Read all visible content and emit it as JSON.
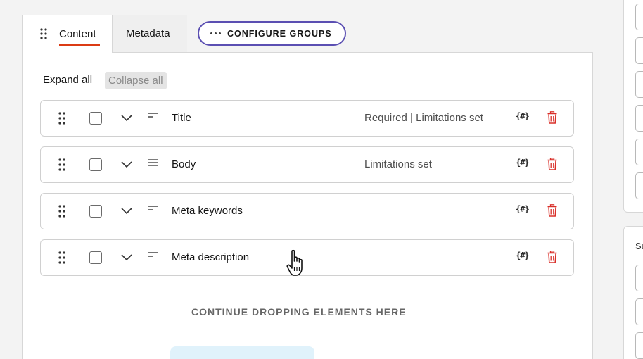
{
  "tabs": {
    "content_label": "Content",
    "metadata_label": "Metadata",
    "configure_groups_label": "CONFIGURE GROUPS"
  },
  "toolbar": {
    "expand_all": "Expand all",
    "collapse_all": "Collapse all"
  },
  "elements": [
    {
      "name": "Title",
      "type_icon": "text-short-icon",
      "status": "Required | Limitations set",
      "macro": "{#}"
    },
    {
      "name": "Body",
      "type_icon": "text-long-icon",
      "status": "Limitations set",
      "macro": "{#}"
    },
    {
      "name": "Meta keywords",
      "type_icon": "text-short-icon",
      "status": "",
      "macro": "{#}"
    },
    {
      "name": "Meta description",
      "type_icon": "text-short-icon",
      "status": "",
      "macro": "{#}"
    }
  ],
  "drop_zone": {
    "label": "CONTINUE DROPPING ELEMENTS HERE"
  },
  "right_panel": {
    "label_fragment": "Su"
  },
  "colors": {
    "accent_underline": "#db3b14",
    "configure_border": "#5b4fb2",
    "delete_icon": "#d9302a",
    "drop_zone": "#e0f2fb"
  }
}
